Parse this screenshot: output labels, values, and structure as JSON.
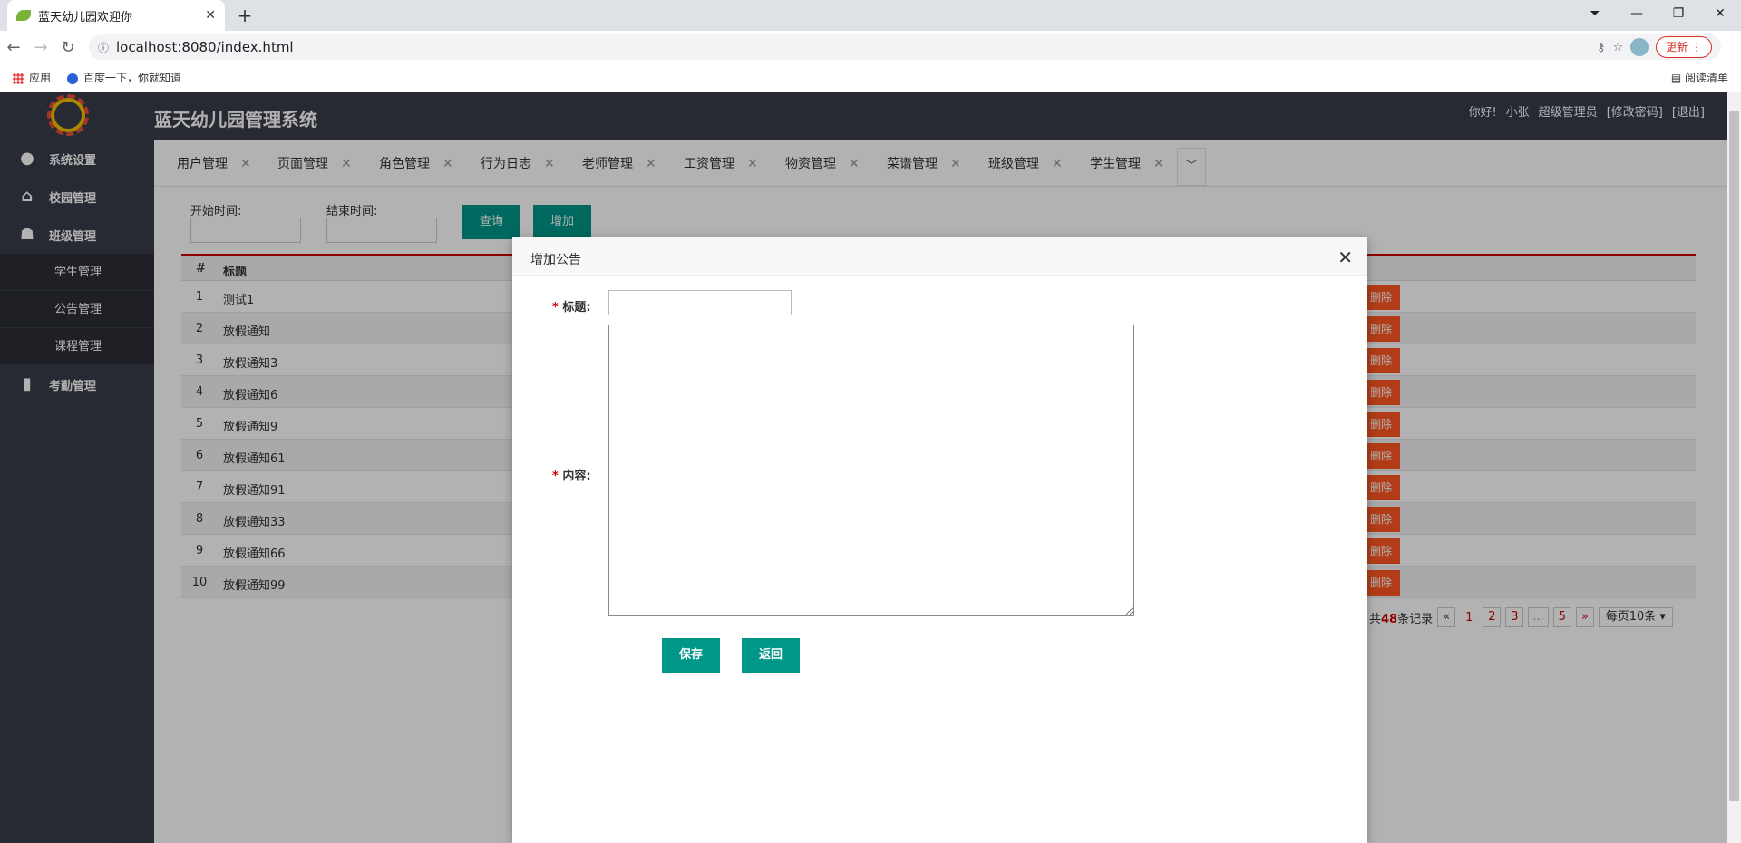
{
  "browser": {
    "tab_title": "蓝天幼儿园欢迎你",
    "url": "localhost:8080/index.html",
    "update_label": "更新",
    "bookmarks": [
      "应用",
      "百度一下，你就知道"
    ],
    "reading_list": "阅读清单"
  },
  "app": {
    "title": "蓝天幼儿园管理系统",
    "greeting": "你好!",
    "username": "小张",
    "role": "超级管理员",
    "change_password": "[修改密码]",
    "logout": "[退出]"
  },
  "sidebar": {
    "menus": [
      {
        "label": "系统设置",
        "icon": "user-icon"
      },
      {
        "label": "校园管理",
        "icon": "home-icon"
      },
      {
        "label": "班级管理",
        "icon": "group-icon"
      },
      {
        "label": "考勤管理",
        "icon": "bar-chart-icon"
      }
    ],
    "submenus": [
      "学生管理",
      "公告管理",
      "课程管理"
    ]
  },
  "tabs": [
    "用户管理",
    "页面管理",
    "角色管理",
    "行为日志",
    "老师管理",
    "工资管理",
    "物资管理",
    "菜谱管理",
    "班级管理",
    "学生管理"
  ],
  "filters": {
    "start_label": "开始时间:",
    "end_label": "结束时间:",
    "query_label": "查询",
    "add_label": "增加"
  },
  "table": {
    "headers": [
      "#",
      "标题"
    ],
    "rows": [
      {
        "n": "1",
        "title": "测试1"
      },
      {
        "n": "2",
        "title": "放假通知"
      },
      {
        "n": "3",
        "title": "放假通知3"
      },
      {
        "n": "4",
        "title": "放假通知6"
      },
      {
        "n": "5",
        "title": "放假通知9"
      },
      {
        "n": "6",
        "title": "放假通知61"
      },
      {
        "n": "7",
        "title": "放假通知91"
      },
      {
        "n": "8",
        "title": "放假通知33"
      },
      {
        "n": "9",
        "title": "放假通知66"
      },
      {
        "n": "10",
        "title": "放假通知99"
      }
    ],
    "delete_label": "删除"
  },
  "pager": {
    "total_prefix": "共",
    "total": "48",
    "total_suffix": "条记录",
    "prev": "«",
    "pages": [
      "1",
      "2",
      "3",
      "...",
      "5"
    ],
    "next": "»",
    "page_size": "每页10条"
  },
  "modal": {
    "title": "增加公告",
    "title_label": "标题:",
    "content_label": "内容:",
    "required_mark": "*",
    "save_label": "保存",
    "back_label": "返回",
    "title_value": "",
    "content_value": ""
  }
}
